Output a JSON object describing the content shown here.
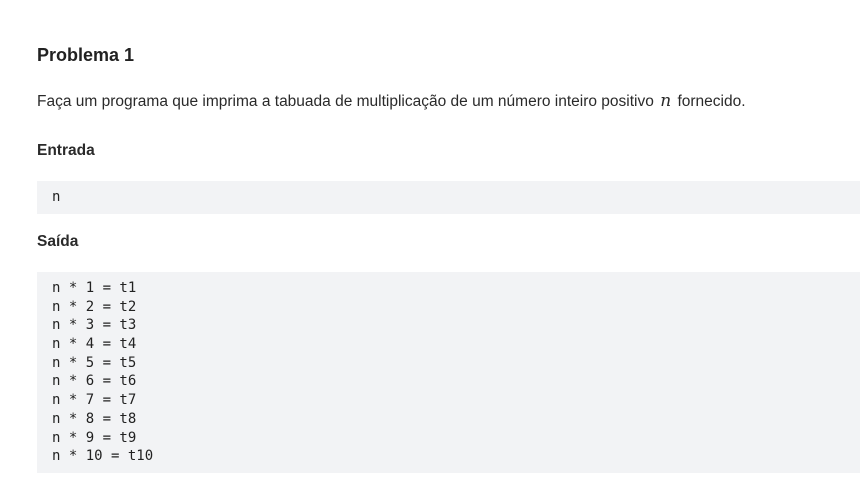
{
  "problem": {
    "title": "Problema 1",
    "description_before": "Faça um programa que imprima a tabuada de multiplicação de um número inteiro positivo",
    "description_var": "n",
    "description_after": "fornecido."
  },
  "input_section": {
    "heading": "Entrada",
    "lines": [
      "n"
    ]
  },
  "output_section": {
    "heading": "Saída",
    "lines": [
      "n * 1 = t1",
      "n * 2 = t2",
      "n * 3 = t3",
      "n * 4 = t4",
      "n * 5 = t5",
      "n * 6 = t6",
      "n * 7 = t7",
      "n * 8 = t8",
      "n * 9 = t9",
      "n * 10 = t10"
    ]
  }
}
